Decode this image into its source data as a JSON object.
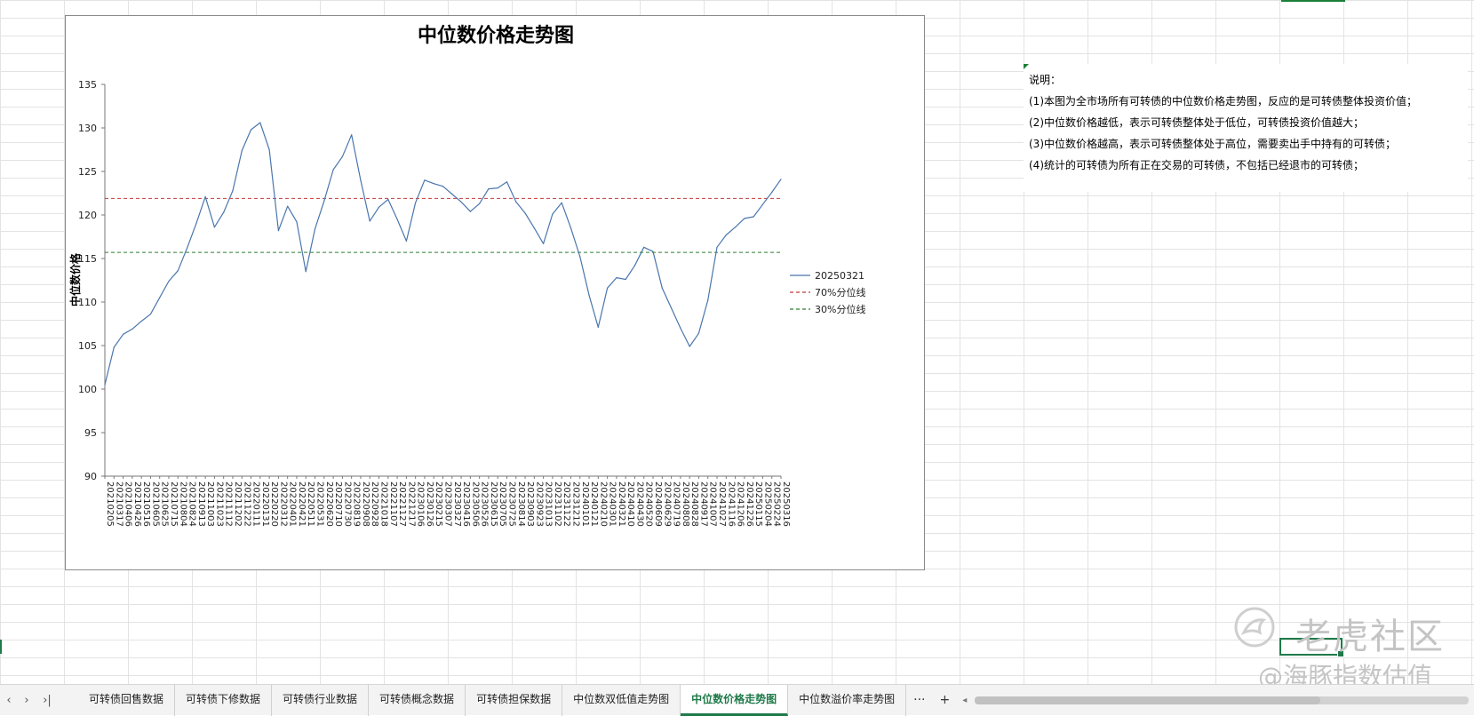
{
  "chart_data": {
    "type": "line",
    "title": "中位数价格走势图",
    "ylabel": "中位数价格",
    "xlabel": "",
    "ylim": [
      90,
      135
    ],
    "yticks": [
      90,
      95,
      100,
      105,
      110,
      115,
      120,
      125,
      130,
      135
    ],
    "x_tick_labels": [
      "20210205",
      "20210317",
      "20210406",
      "20210426",
      "20210516",
      "20210605",
      "20210625",
      "20210715",
      "20210804",
      "20210824",
      "20210913",
      "20211003",
      "20211023",
      "20211112",
      "20211202",
      "20211222",
      "20220111",
      "20220131",
      "20220220",
      "20220312",
      "20220401",
      "20220421",
      "20220511",
      "20220531",
      "20220620",
      "20220710",
      "20220730",
      "20220819",
      "20220908",
      "20220928",
      "20221018",
      "20221107",
      "20221127",
      "20221217",
      "20230106",
      "20230126",
      "20230215",
      "20230307",
      "20230327",
      "20230416",
      "20230506",
      "20230526",
      "20230615",
      "20230705",
      "20230725",
      "20230814",
      "20230903",
      "20230923",
      "20231013",
      "20231102",
      "20231122",
      "20231212",
      "20240101",
      "20240121",
      "20240210",
      "20240301",
      "20240321",
      "20240410",
      "20240430",
      "20240520",
      "20240609",
      "20240629",
      "20240719",
      "20240808",
      "20240828",
      "20240917",
      "20241007",
      "20241027",
      "20241116",
      "20241206",
      "20241226",
      "20250115",
      "20250204",
      "20250224",
      "20250316"
    ],
    "series": [
      {
        "name": "20250321",
        "color": "#4a76ad",
        "style": "solid",
        "values": [
          100.5,
          104.8,
          106.3,
          106.9,
          107.8,
          108.6,
          110.5,
          112.4,
          113.6,
          116.2,
          119.0,
          122.1,
          118.6,
          120.3,
          122.8,
          127.4,
          129.8,
          130.6,
          127.5,
          118.2,
          121.0,
          119.2,
          113.5,
          118.4,
          121.6,
          125.2,
          126.7,
          129.2,
          124.0,
          119.3,
          120.9,
          121.8,
          119.5,
          117.0,
          121.4,
          124.0,
          123.6,
          123.3,
          122.4,
          121.5,
          120.4,
          121.3,
          123.0,
          123.1,
          123.8,
          121.5,
          120.2,
          118.5,
          116.7,
          120.1,
          121.4,
          118.5,
          115.2,
          110.8,
          107.1,
          111.6,
          112.8,
          112.6,
          114.2,
          116.3,
          115.8,
          111.6,
          109.3,
          107.0,
          104.9,
          106.4,
          110.2,
          116.3,
          117.7,
          118.6,
          119.6,
          119.8,
          121.2,
          122.6,
          124.1
        ]
      },
      {
        "name": "70%分位线",
        "color": "#c0393b",
        "style": "dashed",
        "value": 121.9
      },
      {
        "name": "30%分位线",
        "color": "#2e7d32",
        "style": "dashed",
        "value": 115.7
      }
    ],
    "legend_position": "right",
    "grid": false
  },
  "notes": {
    "heading": "说明：",
    "lines": [
      "(1)本图为全市场所有可转债的中位数价格走势图，反应的是可转债整体投资价值；",
      "(2)中位数价格越低，表示可转债整体处于低位，可转债投资价值越大；",
      "(3)中位数价格越高，表示可转债整体处于高位，需要卖出手中持有的可转债；",
      "(4)统计的可转债为所有正在交易的可转债，不包括已经退市的可转债；"
    ]
  },
  "watermark": {
    "brand": "老虎社区",
    "sub": "@海豚指数估值"
  },
  "tabbar": {
    "nav_prev": "‹",
    "nav_next": "›",
    "nav_last": "›|",
    "tabs": [
      {
        "label": "可转债回售数据",
        "active": false
      },
      {
        "label": "可转债下修数据",
        "active": false
      },
      {
        "label": "可转债行业数据",
        "active": false
      },
      {
        "label": "可转债概念数据",
        "active": false
      },
      {
        "label": "可转债担保数据",
        "active": false
      },
      {
        "label": "中位数双低值走势图",
        "active": false
      },
      {
        "label": "中位数价格走势图",
        "active": true
      },
      {
        "label": "中位数溢价率走势图",
        "active": false
      }
    ],
    "more": "···",
    "add": "+"
  },
  "colors": {
    "accent": "#1f7a4a",
    "line": "#4a76ad",
    "p70": "#c0393b",
    "p30": "#2e7d32"
  }
}
